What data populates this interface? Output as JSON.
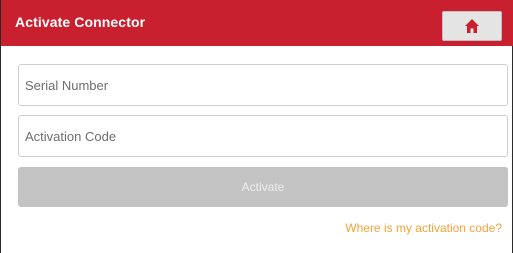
{
  "header": {
    "title": "Activate Connector",
    "background_color": "#c8202f",
    "home_icon": "home-icon"
  },
  "form": {
    "serial_placeholder": "Serial Number",
    "serial_value": "",
    "code_placeholder": "Activation Code",
    "code_value": "",
    "activate_label": "Activate",
    "button_color": "#c3c3c3"
  },
  "help": {
    "link_text": "Where is my activation code?",
    "link_color": "#f3a23b"
  }
}
